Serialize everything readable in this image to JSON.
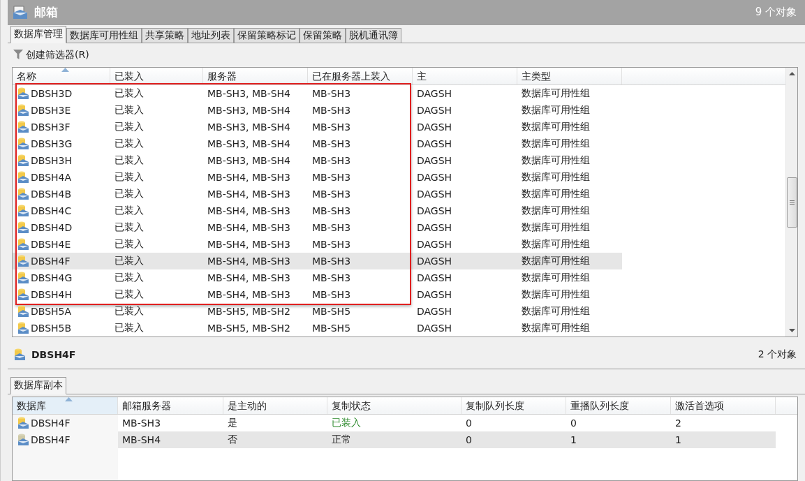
{
  "window": {
    "title": "邮箱",
    "count": "9 个对象"
  },
  "tabs": [
    {
      "label": "数据库管理",
      "selected": true
    },
    {
      "label": "数据库可用性组",
      "selected": false
    },
    {
      "label": "共享策略",
      "selected": false
    },
    {
      "label": "地址列表",
      "selected": false
    },
    {
      "label": "保留策略标记",
      "selected": false
    },
    {
      "label": "保留策略",
      "selected": false
    },
    {
      "label": "脱机通讯簿",
      "selected": false
    }
  ],
  "toolbar": {
    "filter_button": "创建筛选器(R)"
  },
  "table": {
    "columns": [
      "名称",
      "已装入",
      "服务器",
      "已在服务器上装入",
      "主",
      "主类型"
    ],
    "row_groups": [
      {
        "highlighted": true,
        "rows": [
          {
            "cells": [
              "DBSH3D",
              "已装入",
              "MB-SH3, MB-SH4",
              "MB-SH3",
              "DAGSH",
              "数据库可用性组"
            ],
            "selected": false
          },
          {
            "cells": [
              "DBSH3E",
              "已装入",
              "MB-SH3, MB-SH4",
              "MB-SH3",
              "DAGSH",
              "数据库可用性组"
            ],
            "selected": false
          },
          {
            "cells": [
              "DBSH3F",
              "已装入",
              "MB-SH3, MB-SH4",
              "MB-SH3",
              "DAGSH",
              "数据库可用性组"
            ],
            "selected": false
          },
          {
            "cells": [
              "DBSH3G",
              "已装入",
              "MB-SH3, MB-SH4",
              "MB-SH3",
              "DAGSH",
              "数据库可用性组"
            ],
            "selected": false
          },
          {
            "cells": [
              "DBSH3H",
              "已装入",
              "MB-SH3, MB-SH4",
              "MB-SH3",
              "DAGSH",
              "数据库可用性组"
            ],
            "selected": false
          },
          {
            "cells": [
              "DBSH4A",
              "已装入",
              "MB-SH4, MB-SH3",
              "MB-SH3",
              "DAGSH",
              "数据库可用性组"
            ],
            "selected": false
          },
          {
            "cells": [
              "DBSH4B",
              "已装入",
              "MB-SH4, MB-SH3",
              "MB-SH3",
              "DAGSH",
              "数据库可用性组"
            ],
            "selected": false
          },
          {
            "cells": [
              "DBSH4C",
              "已装入",
              "MB-SH4, MB-SH3",
              "MB-SH3",
              "DAGSH",
              "数据库可用性组"
            ],
            "selected": false
          },
          {
            "cells": [
              "DBSH4D",
              "已装入",
              "MB-SH4, MB-SH3",
              "MB-SH3",
              "DAGSH",
              "数据库可用性组"
            ],
            "selected": false
          },
          {
            "cells": [
              "DBSH4E",
              "已装入",
              "MB-SH4, MB-SH3",
              "MB-SH3",
              "DAGSH",
              "数据库可用性组"
            ],
            "selected": false
          },
          {
            "cells": [
              "DBSH4F",
              "已装入",
              "MB-SH4, MB-SH3",
              "MB-SH3",
              "DAGSH",
              "数据库可用性组"
            ],
            "selected": true
          },
          {
            "cells": [
              "DBSH4G",
              "已装入",
              "MB-SH4, MB-SH3",
              "MB-SH3",
              "DAGSH",
              "数据库可用性组"
            ],
            "selected": false
          },
          {
            "cells": [
              "DBSH4H",
              "已装入",
              "MB-SH4, MB-SH3",
              "MB-SH3",
              "DAGSH",
              "数据库可用性组"
            ],
            "selected": false
          }
        ]
      },
      {
        "highlighted": false,
        "rows": [
          {
            "cells": [
              "DBSH5A",
              "已装入",
              "MB-SH5, MB-SH2",
              "MB-SH5",
              "DAGSH",
              "数据库可用性组"
            ],
            "selected": false
          },
          {
            "cells": [
              "DBSH5B",
              "已装入",
              "MB-SH5, MB-SH2",
              "MB-SH5",
              "DAGSH",
              "数据库可用性组"
            ],
            "selected": false
          }
        ]
      }
    ]
  },
  "details": {
    "title": "DBSH4F",
    "count": "2 个对象",
    "tabs": [
      {
        "label": "数据库副本",
        "selected": true
      }
    ],
    "table": {
      "columns": [
        "数据库",
        "邮箱服务器",
        "是主动的",
        "复制状态",
        "复制队列长度",
        "重播队列长度",
        "激活首选项"
      ],
      "rows": [
        {
          "cells": [
            "DBSH4F",
            "MB-SH3",
            "是",
            "已装入",
            "0",
            "0",
            "2"
          ],
          "active": true,
          "selected": false,
          "status_emphasized": true
        },
        {
          "cells": [
            "DBSH4F",
            "MB-SH4",
            "否",
            "正常",
            "0",
            "1",
            "1"
          ],
          "active": false,
          "selected": true,
          "status_emphasized": false
        }
      ]
    }
  }
}
